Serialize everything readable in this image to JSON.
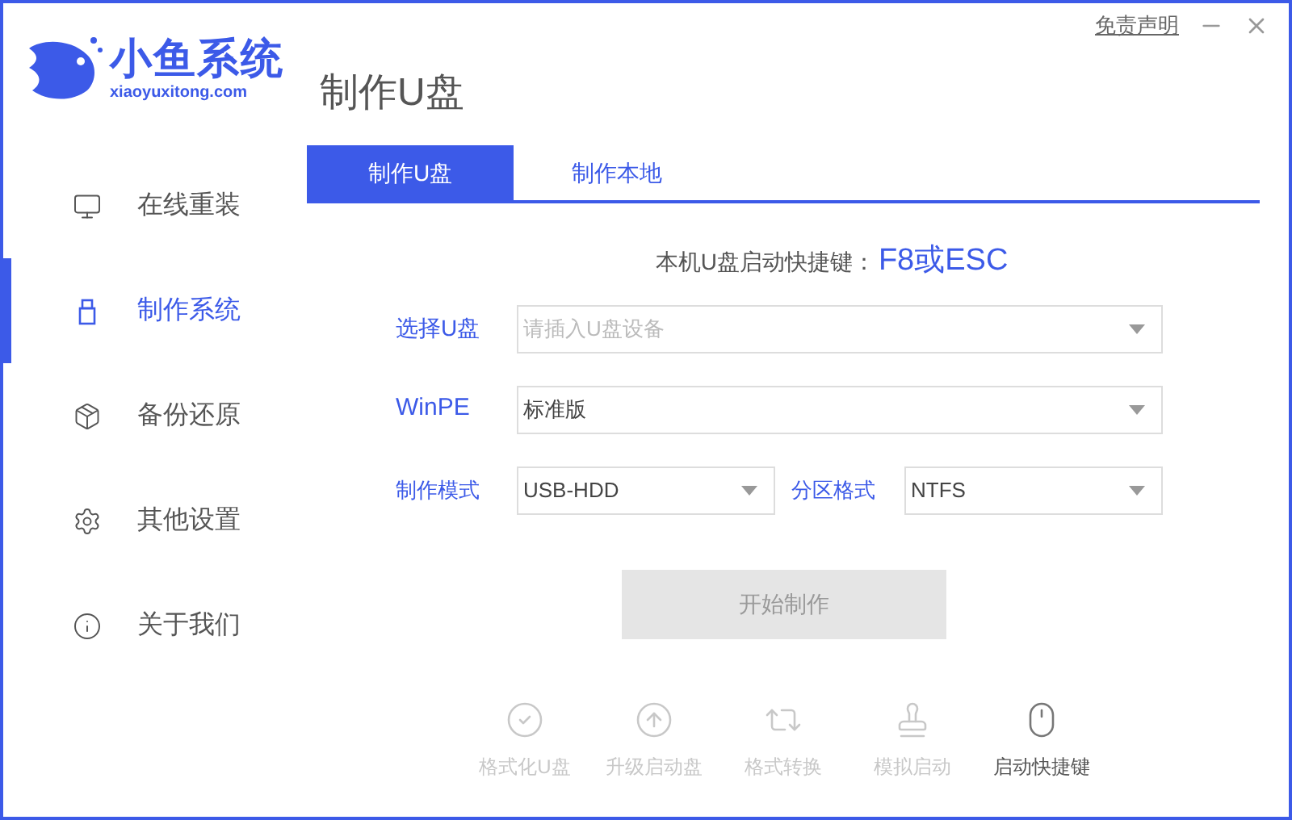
{
  "logo": {
    "name": "小鱼系统",
    "domain": "xiaoyuxitong.com"
  },
  "page_title": "制作U盘",
  "top_links": {
    "disclaimer": "免责声明"
  },
  "sidebar": {
    "items": [
      {
        "label": "在线重装",
        "kind": "monitor",
        "selected": false
      },
      {
        "label": "制作系统",
        "kind": "usb",
        "selected": true
      },
      {
        "label": "备份还原",
        "kind": "backup",
        "selected": false
      },
      {
        "label": "其他设置",
        "kind": "settings",
        "selected": false
      },
      {
        "label": "关于我们",
        "kind": "info",
        "selected": false
      }
    ]
  },
  "tabs": [
    {
      "label": "制作U盘",
      "selected": true
    },
    {
      "label": "制作本地",
      "selected": false
    }
  ],
  "shortcut": {
    "label": "本机U盘启动快捷键：",
    "value": "F8或ESC"
  },
  "form": {
    "usb": {
      "label": "选择U盘",
      "placeholder": "请插入U盘设备"
    },
    "winpe": {
      "label": "WinPE",
      "value": "标准版"
    },
    "mode": {
      "label": "制作模式",
      "value": "USB-HDD"
    },
    "partition": {
      "label": "分区格式",
      "value": "NTFS"
    }
  },
  "start_button": {
    "label": "开始制作",
    "disabled": true
  },
  "tools": [
    {
      "label": "格式化U盘",
      "kind": "check",
      "disabled": true
    },
    {
      "label": "升级启动盘",
      "kind": "upload",
      "disabled": true
    },
    {
      "label": "格式转换",
      "kind": "convert",
      "disabled": true
    },
    {
      "label": "模拟启动",
      "kind": "stamp",
      "disabled": true
    },
    {
      "label": "启动快捷键",
      "kind": "mouse",
      "disabled": false
    }
  ]
}
